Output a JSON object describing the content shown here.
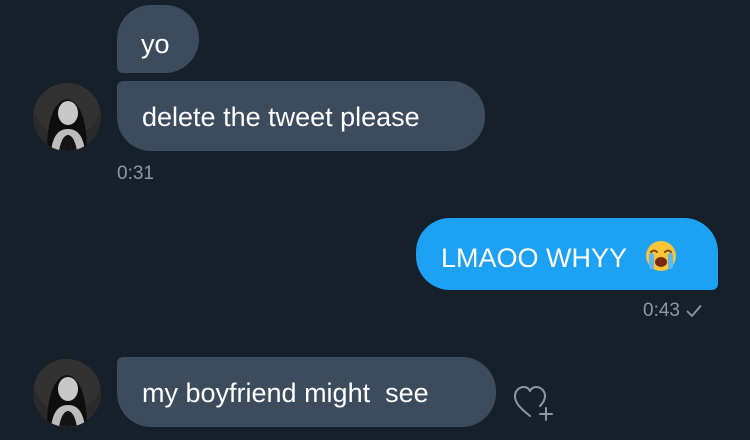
{
  "conversation": {
    "messages": [
      {
        "text": "yo"
      },
      {
        "text": "delete the tweet please",
        "timestamp": "0:31"
      },
      {
        "text": "LMAOO WHYY",
        "emoji": "loudly-crying-face",
        "timestamp": "0:43",
        "status": "sent"
      },
      {
        "text": "my boyfriend might  see"
      }
    ]
  },
  "colors": {
    "background": "#16202b",
    "incoming_bubble": "#3c4c5c",
    "outgoing_bubble": "#1da1f2",
    "timestamp": "#8b98a5"
  },
  "icons": {
    "emoji": "loudly-crying-face-emoji",
    "delivery": "checkmark-icon",
    "reaction": "heart-plus-icon"
  }
}
